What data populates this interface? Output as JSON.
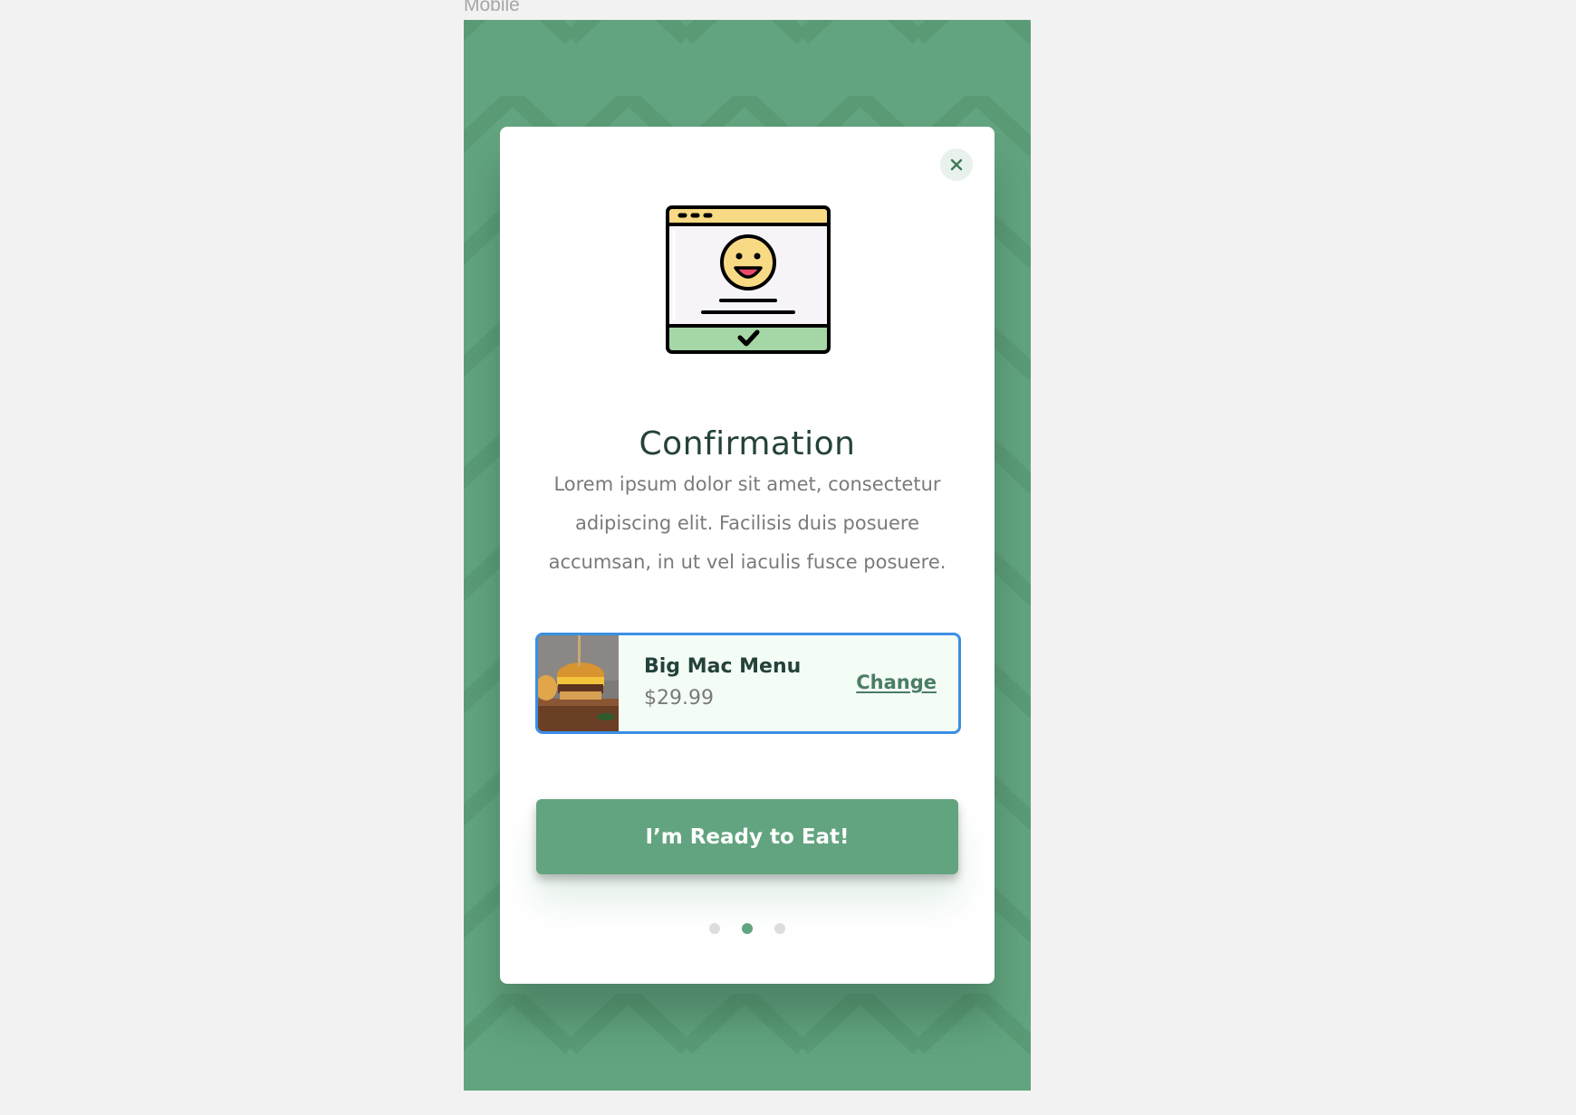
{
  "frame": {
    "label": "Mobile"
  },
  "modal": {
    "close_icon": "close-icon",
    "illustration_icon": "browser-smiley-check-icon",
    "title": "Confirmation",
    "description": "Lorem ipsum dolor sit amet, consectetur adipiscing elit. Facilisis duis posuere accumsan, in ut vel iaculis fusce posuere.",
    "item": {
      "name": "Big Mac Menu",
      "price": "$29.99",
      "change_label": "Change",
      "image": "burger-photo"
    },
    "cta_label": "I’m Ready to Eat!",
    "pagination": {
      "total": 3,
      "active": 2
    }
  },
  "colors": {
    "brand_green": "#62a47f",
    "heading": "#24423a",
    "body_text": "#7a7a7a",
    "selected_border": "#3a8fe6",
    "card_bg": "#f4fcf6"
  }
}
